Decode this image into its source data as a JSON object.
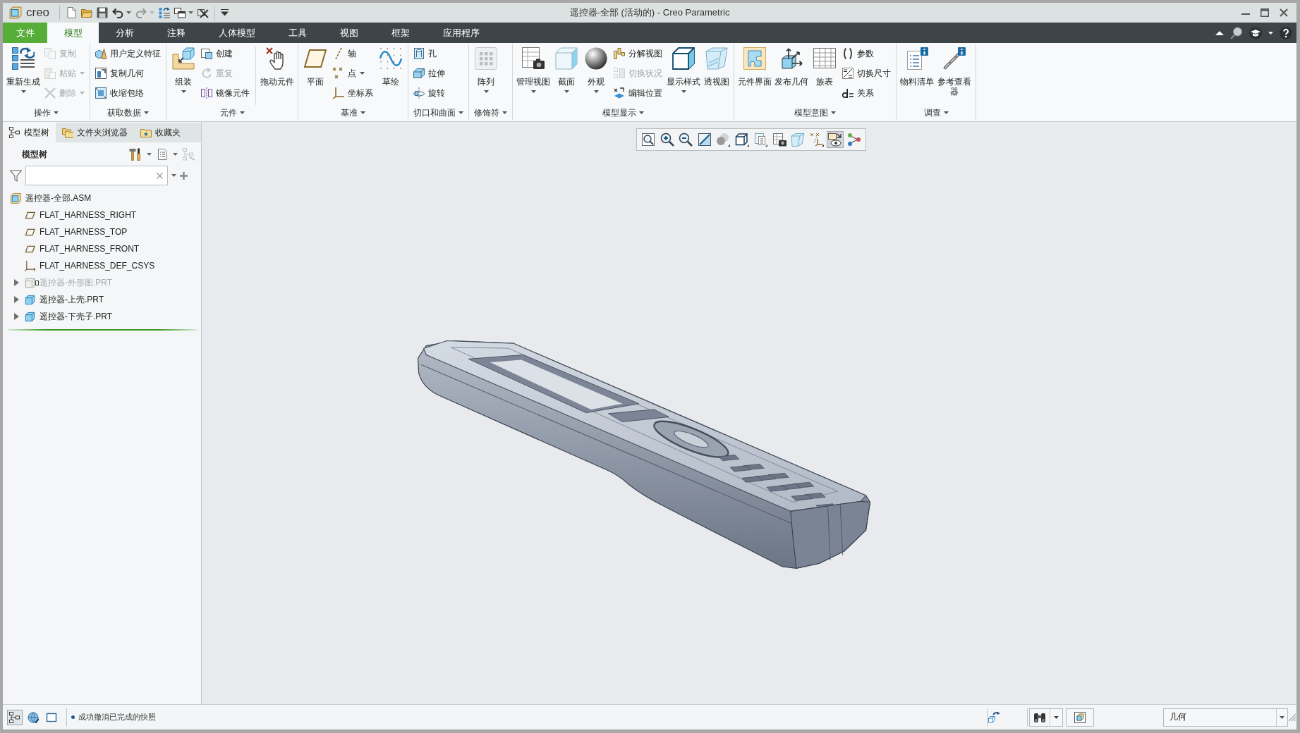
{
  "window": {
    "logo_text": "creo",
    "title": "遥控器-全部 (活动的) - Creo Parametric"
  },
  "quick_access": [
    {
      "disabled": false,
      "has_menu": false
    },
    {
      "disabled": false,
      "has_menu": false
    },
    {
      "disabled": false,
      "has_menu": false
    },
    {
      "disabled": false,
      "has_menu": true
    },
    {
      "disabled": true,
      "has_menu": true
    },
    {
      "disabled": false,
      "has_menu": false
    },
    {
      "disabled": false,
      "has_menu": true
    },
    {
      "disabled": false,
      "has_menu": false
    }
  ],
  "ribbon": {
    "tabs": [
      {
        "label": "文件",
        "kind": "file",
        "selected": false
      },
      {
        "label": "模型",
        "kind": "tab",
        "selected": true
      },
      {
        "label": "分析",
        "kind": "tab",
        "selected": false
      },
      {
        "label": "注释",
        "kind": "tab",
        "selected": false
      },
      {
        "label": "人体模型",
        "kind": "tab",
        "selected": false
      },
      {
        "label": "工具",
        "kind": "tab",
        "selected": false
      },
      {
        "label": "视图",
        "kind": "tab",
        "selected": false
      },
      {
        "label": "框架",
        "kind": "tab",
        "selected": false
      },
      {
        "label": "应用程序",
        "kind": "tab",
        "selected": false
      }
    ],
    "groups": [
      {
        "label": "操作",
        "items": [
          {
            "kind": "large",
            "label": "重新生成",
            "disabled": false,
            "has_menu": true
          },
          {
            "kind": "small",
            "label": "复制",
            "disabled": true,
            "has_menu": false
          },
          {
            "kind": "small",
            "label": "粘贴",
            "disabled": true,
            "has_menu": true
          },
          {
            "kind": "small",
            "label": "删除",
            "disabled": true,
            "has_menu": true
          }
        ]
      },
      {
        "label": "获取数据",
        "items": [
          {
            "kind": "small",
            "label": "用户定义特征",
            "disabled": false,
            "has_menu": false
          },
          {
            "kind": "small",
            "label": "复制几何",
            "disabled": false,
            "has_menu": false
          },
          {
            "kind": "small",
            "label": "收缩包络",
            "disabled": false,
            "has_menu": false
          }
        ]
      },
      {
        "label": "元件",
        "items": [
          {
            "kind": "large",
            "label": "组装",
            "disabled": false,
            "has_menu": true
          },
          {
            "kind": "small",
            "label": "创建",
            "disabled": false,
            "has_menu": false
          },
          {
            "kind": "small",
            "label": "重复",
            "disabled": true,
            "has_menu": false
          },
          {
            "kind": "small",
            "label": "镜像元件",
            "disabled": false,
            "has_menu": false
          },
          {
            "kind": "large",
            "label": "拖动元件",
            "disabled": false,
            "has_menu": false
          }
        ]
      },
      {
        "label": "基准",
        "items": [
          {
            "kind": "large",
            "label": "平面",
            "disabled": false,
            "has_menu": false
          },
          {
            "kind": "small",
            "label": "轴",
            "disabled": false,
            "has_menu": false
          },
          {
            "kind": "small",
            "label": "点",
            "disabled": false,
            "has_menu": true
          },
          {
            "kind": "small",
            "label": "坐标系",
            "disabled": false,
            "has_menu": false
          },
          {
            "kind": "large",
            "label": "草绘",
            "disabled": false,
            "has_menu": false
          }
        ]
      },
      {
        "label": "切口和曲面",
        "items": [
          {
            "kind": "small",
            "label": "孔",
            "disabled": false,
            "has_menu": false
          },
          {
            "kind": "small",
            "label": "拉伸",
            "disabled": false,
            "has_menu": false
          },
          {
            "kind": "small",
            "label": "旋转",
            "disabled": false,
            "has_menu": false
          }
        ]
      },
      {
        "label": "修饰符",
        "items": [
          {
            "kind": "large",
            "label": "阵列",
            "disabled": false,
            "has_menu": true
          }
        ]
      },
      {
        "label": "模型显示",
        "items": [
          {
            "kind": "large",
            "label": "管理视图",
            "disabled": false,
            "has_menu": true
          },
          {
            "kind": "large",
            "label": "截面",
            "disabled": false,
            "has_menu": true
          },
          {
            "kind": "large",
            "label": "外观",
            "disabled": false,
            "has_menu": true
          },
          {
            "kind": "small",
            "label": "分解视图",
            "disabled": false,
            "has_menu": false
          },
          {
            "kind": "small",
            "label": "切换状况",
            "disabled": true,
            "has_menu": false
          },
          {
            "kind": "small",
            "label": "编辑位置",
            "disabled": false,
            "has_menu": false
          },
          {
            "kind": "large",
            "label": "显示样式",
            "disabled": false,
            "has_menu": true
          },
          {
            "kind": "large",
            "label": "透视图",
            "disabled": false,
            "has_menu": false
          }
        ]
      },
      {
        "label": "模型意图",
        "items": [
          {
            "kind": "large",
            "label": "元件界面",
            "disabled": false,
            "has_menu": false
          },
          {
            "kind": "large",
            "label": "发布几何",
            "disabled": false,
            "has_menu": false
          },
          {
            "kind": "large",
            "label": "族表",
            "disabled": false,
            "has_menu": false
          },
          {
            "kind": "small",
            "label": "参数",
            "disabled": false,
            "has_menu": false
          },
          {
            "kind": "small",
            "label": "切换尺寸",
            "disabled": false,
            "has_menu": false
          },
          {
            "kind": "small",
            "label": "关系",
            "disabled": false,
            "has_menu": false
          }
        ]
      },
      {
        "label": "调查",
        "items": [
          {
            "kind": "large",
            "label": "物料清单",
            "disabled": false,
            "has_menu": false
          },
          {
            "kind": "large",
            "label": "参考查看器",
            "disabled": false,
            "has_menu": false
          }
        ]
      }
    ]
  },
  "side_panel": {
    "tabs": [
      {
        "label": "模型树",
        "selected": true
      },
      {
        "label": "文件夹浏览器",
        "selected": false
      },
      {
        "label": "收藏夹",
        "selected": false
      }
    ],
    "title": "模型树",
    "tree": [
      {
        "label": "遥控器-全部.ASM",
        "kind": "assembly",
        "disabled": false,
        "children": [
          {
            "label": "FLAT_HARNESS_RIGHT",
            "kind": "datum_plane",
            "disabled": false
          },
          {
            "label": "FLAT_HARNESS_TOP",
            "kind": "datum_plane",
            "disabled": false
          },
          {
            "label": "FLAT_HARNESS_FRONT",
            "kind": "datum_plane",
            "disabled": false
          },
          {
            "label": "FLAT_HARNESS_DEF_CSYS",
            "kind": "coordinate_system",
            "disabled": false
          },
          {
            "label": "遥控器-外形图.PRT",
            "kind": "part",
            "disabled": true,
            "expanded": false
          },
          {
            "label": "遥控器-上壳.PRT",
            "kind": "part",
            "disabled": false,
            "expanded": false
          },
          {
            "label": "遥控器-下壳子.PRT",
            "kind": "part",
            "disabled": false,
            "expanded": false
          }
        ]
      }
    ]
  },
  "view_toolbar": [
    {
      "on": false
    },
    {
      "on": false
    },
    {
      "on": false
    },
    {
      "on": false
    },
    {
      "on": false
    },
    {
      "on": false
    },
    {
      "on": false
    },
    {
      "on": false
    },
    {
      "on": false
    },
    {
      "on": false
    },
    {
      "on": true
    },
    {
      "on": false
    }
  ],
  "status_bar": {
    "left_buttons": [
      {
        "on": true
      },
      {
        "on": false
      },
      {
        "on": false
      }
    ],
    "message": "成功撤消已完成的快照",
    "selection_filter": "几何"
  }
}
